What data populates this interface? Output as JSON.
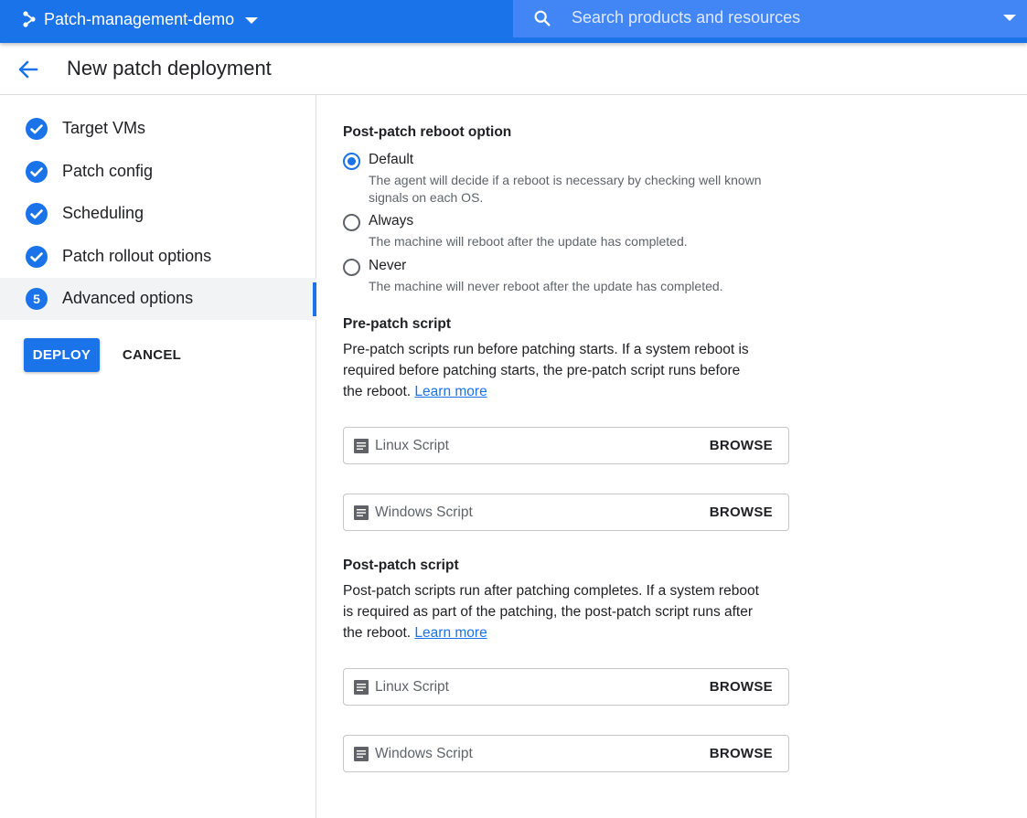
{
  "topbar": {
    "project_name": "Patch-management-demo",
    "search_placeholder": "Search products and resources"
  },
  "header": {
    "title": "New patch deployment"
  },
  "sidebar": {
    "steps": [
      {
        "label": "Target VMs",
        "status": "complete"
      },
      {
        "label": "Patch config",
        "status": "complete"
      },
      {
        "label": "Scheduling",
        "status": "complete"
      },
      {
        "label": "Patch rollout options",
        "status": "complete"
      },
      {
        "label": "Advanced options",
        "status": "active",
        "number": "5"
      }
    ],
    "deploy_label": "DEPLOY",
    "cancel_label": "CANCEL"
  },
  "reboot": {
    "title": "Post-patch reboot option",
    "selected": "Default",
    "options": [
      {
        "label": "Default",
        "description": "The agent will decide if a reboot is necessary by checking well known signals on each OS."
      },
      {
        "label": "Always",
        "description": "The machine will reboot after the update has completed."
      },
      {
        "label": "Never",
        "description": "The machine will never reboot after the update has completed."
      }
    ]
  },
  "pre_patch": {
    "title": "Pre-patch script",
    "description": "Pre-patch scripts run before patching starts. If a system reboot is required before patching starts, the pre-patch script runs before the reboot.",
    "learn_more": "Learn more",
    "scripts": [
      {
        "name": "Linux Script",
        "browse": "BROWSE"
      },
      {
        "name": "Windows Script",
        "browse": "BROWSE"
      }
    ]
  },
  "post_patch": {
    "title": "Post-patch script",
    "description": "Post-patch scripts run after patching completes. If a system reboot is required as part of the patching, the post-patch script runs after the reboot.",
    "learn_more": "Learn more",
    "scripts": [
      {
        "name": "Linux Script",
        "browse": "BROWSE"
      },
      {
        "name": "Windows Script",
        "browse": "BROWSE"
      }
    ]
  },
  "colors": {
    "brand_blue": "#1a73e8",
    "search_bg": "#4285f4"
  }
}
